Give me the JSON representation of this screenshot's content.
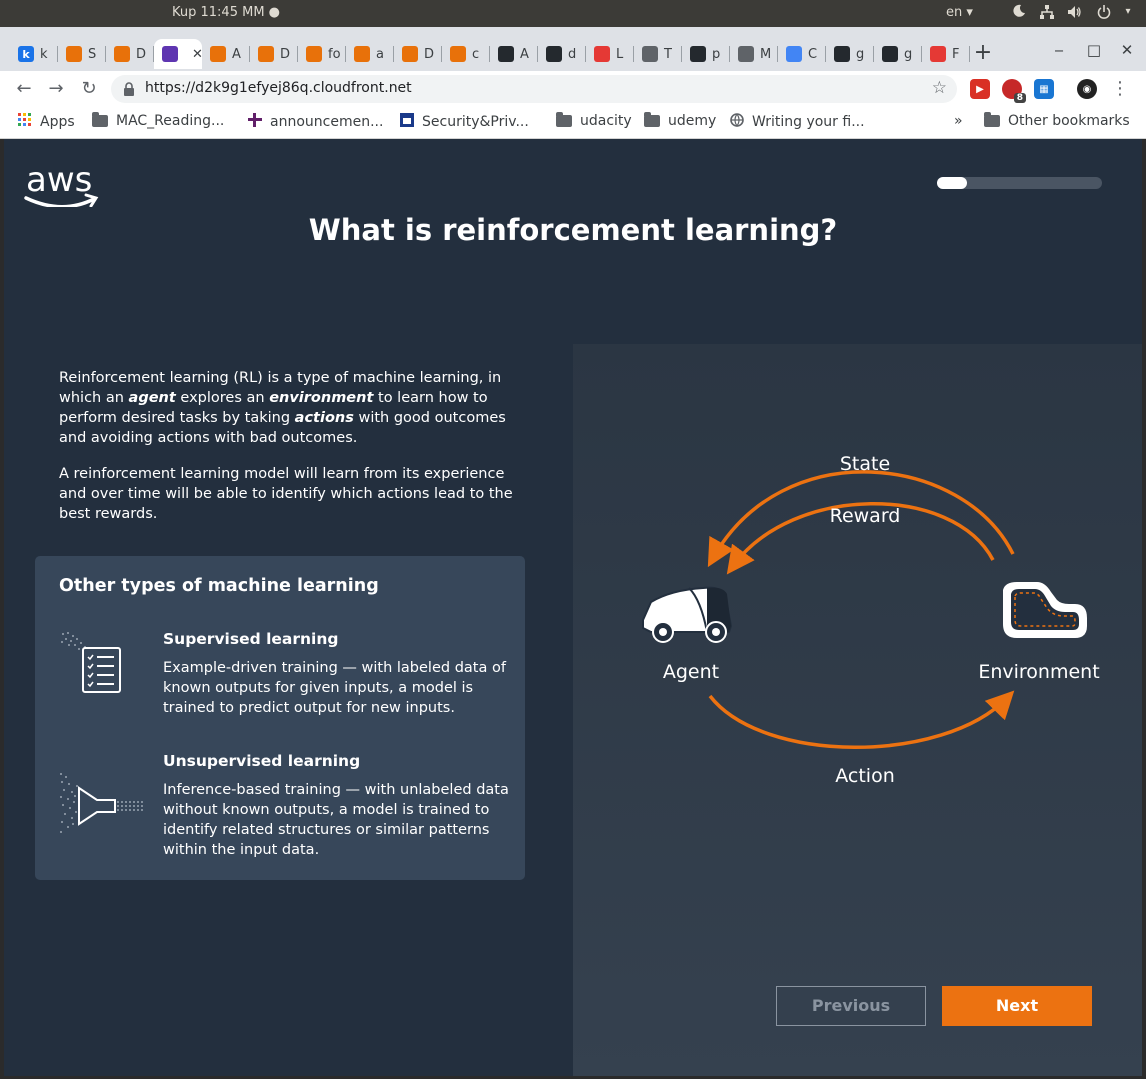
{
  "system_bar": {
    "clock": "Kup 11:45 MM ●",
    "language": "en ▾",
    "icons": [
      "night-mode-icon",
      "network-icon",
      "volume-icon",
      "power-icon"
    ]
  },
  "browser": {
    "tabs": [
      {
        "label": "k",
        "favicon_text": "k",
        "favicon_color": "#1a73e8"
      },
      {
        "label": "S",
        "favicon_color": "#e8710a"
      },
      {
        "label": "D",
        "favicon_color": "#e8710a"
      },
      {
        "label": "",
        "favicon_color": "#5e35b1",
        "active": true
      },
      {
        "label": "A",
        "favicon_color": "#e8710a"
      },
      {
        "label": "D",
        "favicon_color": "#e8710a"
      },
      {
        "label": "fo",
        "favicon_color": "#e8710a"
      },
      {
        "label": "a",
        "favicon_color": "#e8710a"
      },
      {
        "label": "D",
        "favicon_color": "#e8710a"
      },
      {
        "label": "c",
        "favicon_color": "#e8710a"
      },
      {
        "label": "A",
        "favicon_color": "#24292e"
      },
      {
        "label": "d",
        "favicon_color": "#24292e"
      },
      {
        "label": "L",
        "favicon_color": "#e53935"
      },
      {
        "label": "T",
        "favicon_color": "#5f6368"
      },
      {
        "label": "p",
        "favicon_color": "#24292e"
      },
      {
        "label": "M",
        "favicon_color": "#5f6368"
      },
      {
        "label": "C",
        "favicon_color": "#4285f4"
      },
      {
        "label": "g",
        "favicon_color": "#24292e"
      },
      {
        "label": "g",
        "favicon_color": "#24292e"
      },
      {
        "label": "F",
        "favicon_color": "#e53935"
      }
    ],
    "url": "https://d2k9g1efyej86q.cloudfront.net",
    "bookmarks": [
      {
        "label": "Apps",
        "type": "apps"
      },
      {
        "label": "MAC_Reading...",
        "type": "folder"
      },
      {
        "label": "announcemen...",
        "type": "slack"
      },
      {
        "label": "Security&Priv...",
        "type": "site"
      },
      {
        "label": "udacity",
        "type": "folder"
      },
      {
        "label": "udemy",
        "type": "folder"
      },
      {
        "label": "Writing your fi...",
        "type": "globe"
      }
    ],
    "overflow": "»",
    "other_bookmarks": "Other bookmarks",
    "extension_badge": "8"
  },
  "page": {
    "logo": "aws",
    "progress": 0.18,
    "title": "What is reinforcement learning?",
    "intro": {
      "p1_a": "Reinforcement learning (RL) is a type of machine learning, in which an ",
      "p1_agent": "agent",
      "p1_b": " explores an ",
      "p1_environment": "environment",
      "p1_c": " to learn how to perform desired tasks by taking ",
      "p1_actions": "actions",
      "p1_d": " with good outcomes and avoiding actions with bad outcomes.",
      "p2": "A reinforcement learning model will learn from its experience and over time will be able to identify which actions lead to the best rewards."
    },
    "other_types": {
      "title": "Other types of machine learning",
      "supervised": {
        "title": "Supervised learning",
        "text": "Example-driven training — with labeled data of known outputs for given inputs, a model is trained to predict output for new inputs."
      },
      "unsupervised": {
        "title": "Unsupervised learning",
        "text": "Inference-based training — with unlabeled data without known outputs, a model is trained to identify related structures or similar patterns within the input data."
      }
    },
    "diagram": {
      "state": "State",
      "reward": "Reward",
      "agent": "Agent",
      "environment": "Environment",
      "action": "Action",
      "arrow_color": "#ec7211"
    },
    "buttons": {
      "previous": "Previous",
      "next": "Next"
    }
  }
}
